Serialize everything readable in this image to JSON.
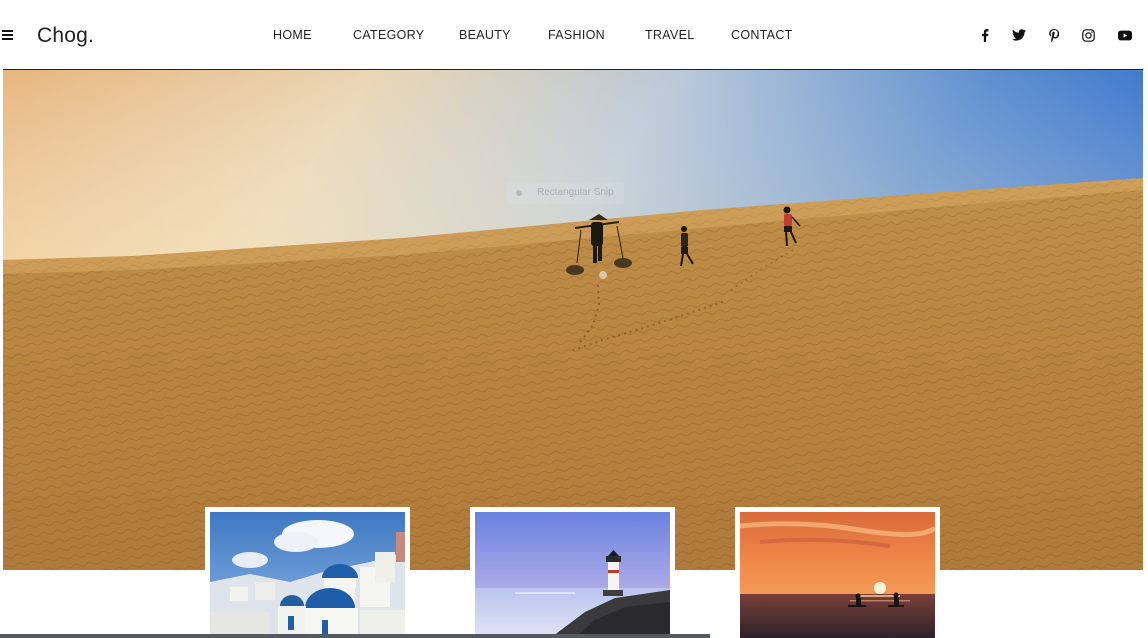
{
  "brand": {
    "logo_text": "Chog."
  },
  "nav": {
    "items": [
      {
        "label": "HOME"
      },
      {
        "label": "CATEGORY"
      },
      {
        "label": "BEAUTY"
      },
      {
        "label": "FASHION"
      },
      {
        "label": "TRAVEL"
      },
      {
        "label": "CONTACT"
      }
    ]
  },
  "socials": [
    {
      "icon": "facebook-icon"
    },
    {
      "icon": "twitter-icon"
    },
    {
      "icon": "pinterest-icon"
    },
    {
      "icon": "instagram-icon"
    },
    {
      "icon": "youtube-icon"
    }
  ],
  "hero": {
    "image": "desert-dunes-with-travelers",
    "overlay_label": "Rectangular Snip"
  },
  "cards": [
    {
      "image": "santorini-blue-domes"
    },
    {
      "image": "lighthouse-at-dusk"
    },
    {
      "image": "sunset-over-sea"
    }
  ],
  "colors": {
    "text": "#222222",
    "header_line": "#222222",
    "background": "#ffffff"
  }
}
